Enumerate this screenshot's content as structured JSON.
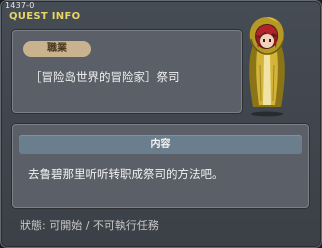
{
  "window": {
    "quest_id": "1437-0",
    "title": "QUEST INFO"
  },
  "job": {
    "tag": "職業",
    "text": "［冒险岛世界的冒险家］祭司"
  },
  "content": {
    "header": "内容",
    "text": "去鲁碧那里听听转职成祭司的方法吧。"
  },
  "status": {
    "text": "狀態: 可開始 / 不可執行任務"
  },
  "colors": {
    "title": "#e8d566",
    "tag_bg": "#c9b28e",
    "header_bg": "#6a7e8e",
    "panel_bg": "#5b6068"
  },
  "icons": {
    "portrait": "hooded-priest-npc-icon"
  }
}
